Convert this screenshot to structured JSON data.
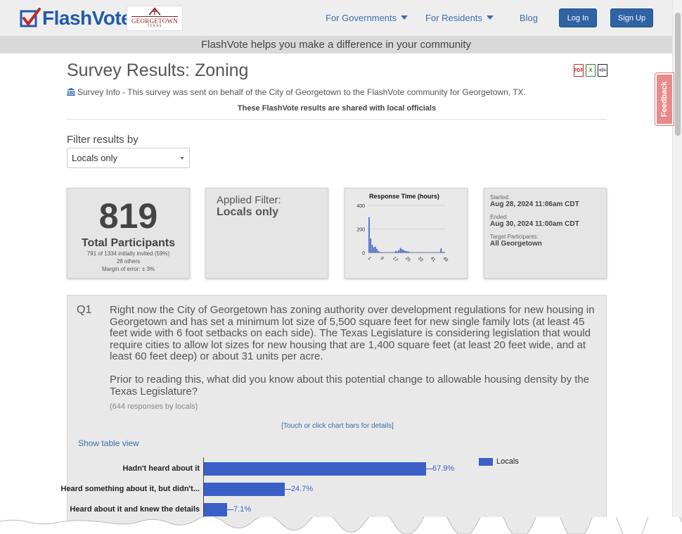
{
  "brand": {
    "name": "FlashVote",
    "partner_name": "GEORGETOWN",
    "partner_sub": "TEXAS"
  },
  "nav": {
    "governments": "For Governments",
    "residents": "For Residents",
    "blog": "Blog",
    "login": "Log In",
    "signup": "Sign Up"
  },
  "tagline": "FlashVote helps you make a difference in your community",
  "feedback": "Feedback",
  "page": {
    "title": "Survey Results: Zoning",
    "survey_info": "Survey Info - This survey was sent on behalf of the City of Georgetown to the FlashVote community for Georgetown, TX.",
    "shared_note": "These FlashVote results are shared with local officials",
    "downloads": [
      "PDF",
      "X",
      "</>"
    ]
  },
  "filter": {
    "label": "Filter results by",
    "selected": "Locals only"
  },
  "stats": {
    "total": "819",
    "total_label": "Total Participants",
    "invited": "791 of 1334 initially invited (59%)",
    "others": "28 others",
    "margin": "Margin of error: ± 3%"
  },
  "applied_filter": {
    "label": "Applied Filter:",
    "value": "Locals only"
  },
  "response_chart": {
    "title": "Response Time (hours)",
    "y_ticks": [
      "400",
      "200",
      "0"
    ],
    "x_ticks": [
      "1",
      "9",
      "17",
      "25",
      "33",
      "41",
      "49"
    ]
  },
  "chart_data": {
    "type": "bar",
    "title": "Response Time (hours)",
    "xlabel": "",
    "ylabel": "",
    "ylim": [
      0,
      400
    ],
    "categories": [
      1,
      2,
      3,
      4,
      5,
      6,
      7,
      8,
      9,
      10,
      11,
      12,
      13,
      14,
      15,
      16,
      17,
      18,
      19,
      20,
      21,
      22,
      23,
      24,
      25,
      26,
      27,
      28,
      29,
      30,
      31,
      32,
      33,
      34,
      35,
      36,
      37,
      38,
      39,
      40,
      41,
      42,
      43,
      44,
      45,
      46,
      47,
      48,
      49
    ],
    "values": [
      300,
      120,
      65,
      45,
      50,
      30,
      12,
      5,
      4,
      3,
      2,
      2,
      2,
      2,
      2,
      2,
      2,
      15,
      10,
      20,
      40,
      30,
      20,
      15,
      12,
      10,
      5,
      4,
      3,
      3,
      3,
      2,
      2,
      2,
      2,
      2,
      2,
      2,
      2,
      2,
      2,
      2,
      2,
      2,
      2,
      2,
      35,
      5,
      5
    ],
    "grid": true
  },
  "timing": {
    "started_label": "Started:",
    "started": "Aug 28, 2024 11:06am CDT",
    "ended_label": "Ended:",
    "ended": "Aug 30, 2024 11:00am CDT",
    "target_label": "Target Participants:",
    "target": "All Georgetown"
  },
  "question": {
    "number": "Q1",
    "text1": "Right now the City of Georgetown has zoning authority over development regulations for new housing in Georgetown and has set a minimum lot size of 5,500 square feet for new single family lots (at least 45 feet wide with 6 foot setbacks on each side). The Texas Legislature is considering legislation that would require cities to allow lot sizes for new housing that are 1,400 square feet (at least 20 feet wide, and at least 60 feet deep) or about 31 units per acre.",
    "text2": "Prior to reading this, what did you know about this potential change to allowable housing density by the Texas Legislature?",
    "responses": "(644 responses by locals)",
    "touch_hint": "[Touch or click chart bars for details]",
    "table_view": "Show table view",
    "legend": "Locals",
    "answers": [
      {
        "label": "Hadn't heard about it",
        "value": "67.9%",
        "pct": 67.9
      },
      {
        "label": "Heard something about it, but didn't...",
        "value": "24.7%",
        "pct": 24.7
      },
      {
        "label": "Heard about it and knew the details",
        "value": "7.1%",
        "pct": 7.1
      }
    ]
  }
}
